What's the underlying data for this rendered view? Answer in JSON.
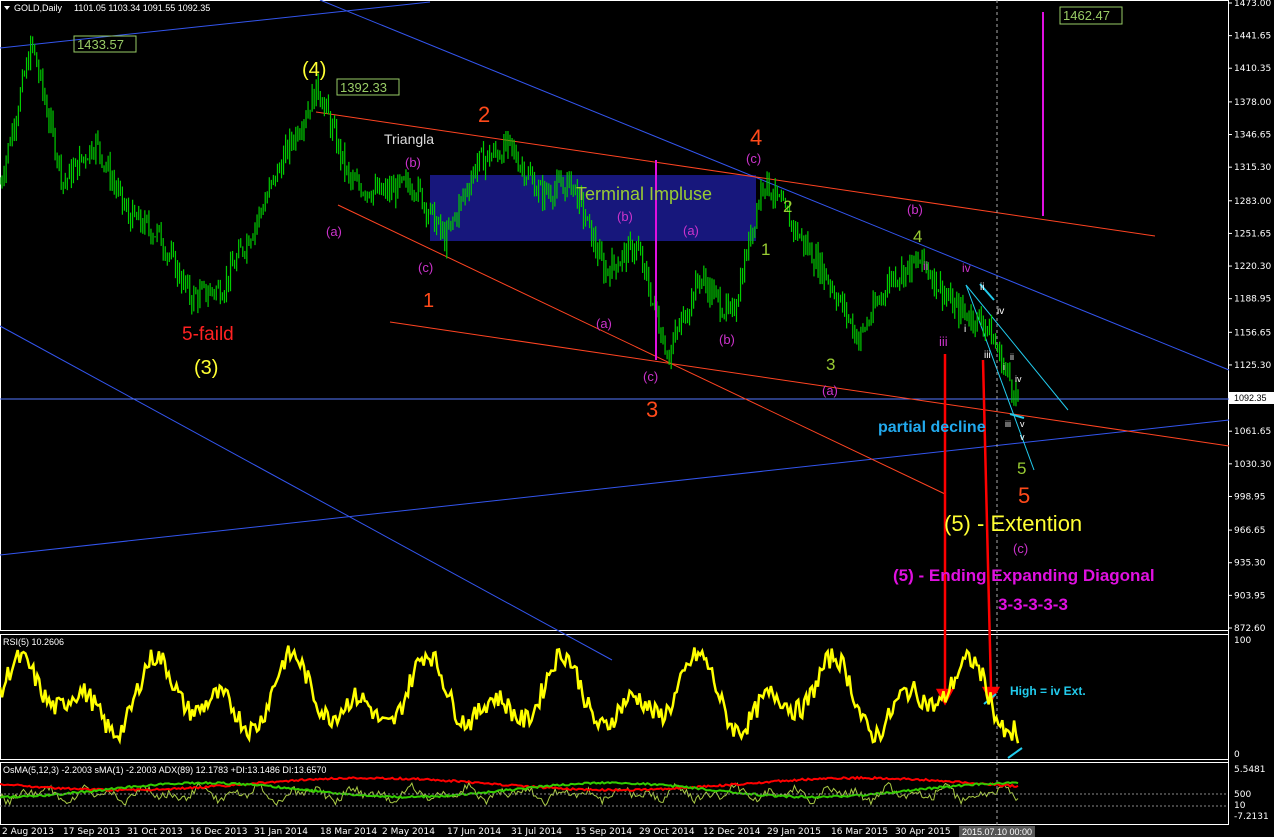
{
  "header": {
    "symbol": "GOLD,Daily",
    "ohlc": "1101.05 1103.34 1091.55 1092.35",
    "rsi_label": "RSI(5) 10.2606",
    "osma_label": "OsMA(5,12,3) -2.2003   sMA(1) -2.2003   ADX(89) 12.1783   +DI:13.1486   DI:13.6570"
  },
  "colors": {
    "background": "#000000",
    "candles": "#00cc00",
    "rsi": "#ffff00",
    "adx_red": "#ff0000",
    "adx_green": "#33cc00",
    "osma": "#aacc44",
    "channel_blue": "#3355ee",
    "trend_red": "#ff4422",
    "box": "#1a1a8a",
    "magenta": "#e010e0",
    "cyan": "#22ccee",
    "orange": "#ff4a1a",
    "yellow": "#ffff33",
    "lime": "#99cc33"
  },
  "chart_data": [
    {
      "type": "candlestick",
      "title": "GOLD,Daily",
      "x_range": [
        "2 Aug 2013",
        "2015-07-10"
      ],
      "ylim": [
        872.6,
        1473.0
      ],
      "y_ticks": [
        "1473.00",
        "1441.65",
        "1410.35",
        "1378.00",
        "1346.65",
        "1315.30",
        "1283.00",
        "1251.65",
        "1220.30",
        "1188.95",
        "1156.65",
        "1125.30",
        "1092.35",
        "1061.65",
        "1030.30",
        "998.95",
        "966.65",
        "935.30",
        "903.95",
        "872.60"
      ],
      "current_price": "1092.35",
      "x_ticks": [
        "2 Aug 2013",
        "17 Sep 2013",
        "31 Oct 2013",
        "16 Dec 2013",
        "31 Jan 2014",
        "18 Mar 2014",
        "2 May 2014",
        "17 Jun 2014",
        "31 Jul 2014",
        "15 Sep 2014",
        "29 Oct 2014",
        "12 Dec 2014",
        "29 Jan 2015",
        "16 Mar 2015",
        "30 Apr 2015"
      ],
      "cursor_date": "2015.07.10 00:00",
      "close_path": [
        [
          "2 Aug 2013",
          1300
        ],
        [
          "Aug 2013",
          1433.57
        ],
        [
          "17 Sep 2013",
          1300
        ],
        [
          "Oct 2013",
          1340
        ],
        [
          "31 Oct 2013",
          1270
        ],
        [
          "Nov 2013",
          1250
        ],
        [
          "16 Dec 2013",
          1190
        ],
        [
          "Dec 2013",
          1200
        ],
        [
          "31 Jan 2014",
          1260
        ],
        [
          "Feb 2014",
          1330
        ],
        [
          "18 Mar 2014",
          1392.33
        ],
        [
          "Mar 2014",
          1300
        ],
        [
          "Apr 2014",
          1290
        ],
        [
          "2 May 2014",
          1300
        ],
        [
          "May 2014",
          1245
        ],
        [
          "17 Jun 2014",
          1320
        ],
        [
          "Jul 2014",
          1335
        ],
        [
          "31 Jul 2014",
          1290
        ],
        [
          "Aug 2014",
          1300
        ],
        [
          "15 Sep 2014",
          1215
        ],
        [
          "Oct 2014",
          1240
        ],
        [
          "29 Oct 2014",
          1135
        ],
        [
          "Nov 2014",
          1210
        ],
        [
          "12 Dec 2014",
          1170
        ],
        [
          "Jan 2015",
          1305
        ],
        [
          "29 Jan 2015",
          1255
        ],
        [
          "Feb 2015",
          1210
        ],
        [
          "16 Mar 2015",
          1150
        ],
        [
          "Apr 2015",
          1210
        ],
        [
          "30 Apr 2015",
          1225
        ],
        [
          "May 2015",
          1180
        ],
        [
          "Jun 2015",
          1165
        ],
        [
          "2015-07-10",
          1092.35
        ]
      ],
      "price_labels": [
        "1433.57",
        "1392.33",
        "1462.47"
      ]
    },
    {
      "type": "line",
      "title": "RSI(5) 10.2606",
      "ylim": [
        0,
        100
      ],
      "y_ticks": [
        "100",
        "0"
      ],
      "series": [
        {
          "name": "RSI(5)",
          "last": 10.2606
        }
      ]
    },
    {
      "type": "line",
      "title": "OsMA(5,12,3)",
      "y_ticks": [
        "5.5481",
        "500",
        "10",
        "-7.2131"
      ],
      "values": {
        "osma": -2.2003,
        "sma": -2.2003,
        "adx": 12.1783,
        "plus_di": 13.1486,
        "minus_di": 13.657
      }
    }
  ],
  "annotations": {
    "triangla": "Triangla",
    "terminal": "Terminal Impluse",
    "five_faild": "5-faild",
    "three_paren": "(3)",
    "four_paren": "(4)",
    "partial": "partial decline",
    "extention": "(5) -  Extention",
    "ending": "(5) - Ending Expanding Diagonal",
    "seq": "3-3-3-3-3",
    "high_iv": "High = iv Ext.",
    "b": "(b)",
    "a": "(a)",
    "c": "(c)",
    "n1": "1",
    "n2": "2",
    "n3": "3",
    "n4": "4",
    "n5": "5",
    "r_i": "i",
    "r_ii": "ii",
    "r_iii": "iii",
    "r_iv": "iv",
    "r_v": "v"
  }
}
